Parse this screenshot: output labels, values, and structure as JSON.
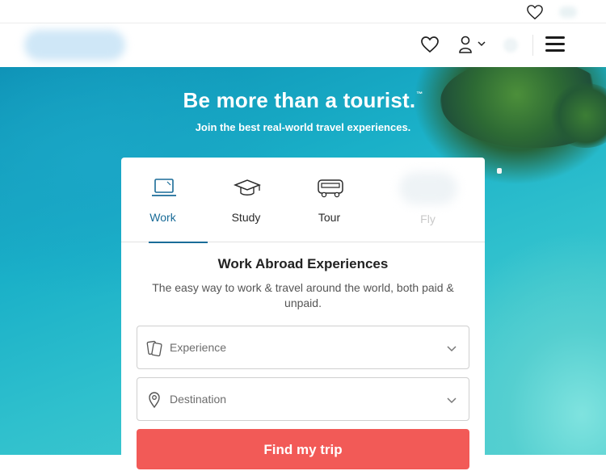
{
  "header": {
    "icons": {
      "top_heart": "heart-icon",
      "nav_heart": "heart-icon",
      "user": "user-icon",
      "menu": "hamburger-menu-icon"
    }
  },
  "hero": {
    "title": "Be more than a tourist.",
    "title_mark": "™",
    "subtitle": "Join the best real-world travel experiences."
  },
  "tabs": [
    {
      "label": "Work",
      "icon": "laptop-icon",
      "active": true
    },
    {
      "label": "Study",
      "icon": "graduation-cap-icon",
      "active": false
    },
    {
      "label": "Tour",
      "icon": "bus-icon",
      "active": false
    },
    {
      "label": "Fly",
      "icon": "plane-icon",
      "active": false
    }
  ],
  "form": {
    "title": "Work Abroad Experiences",
    "description": "The easy way to work & travel around the world, both paid & unpaid.",
    "experience_placeholder": "Experience",
    "destination_placeholder": "Destination",
    "submit_label": "Find my trip"
  },
  "colors": {
    "accent": "#1a6c98",
    "cta": "#f25a57",
    "text_dark": "#222222",
    "text_muted": "#555555"
  }
}
